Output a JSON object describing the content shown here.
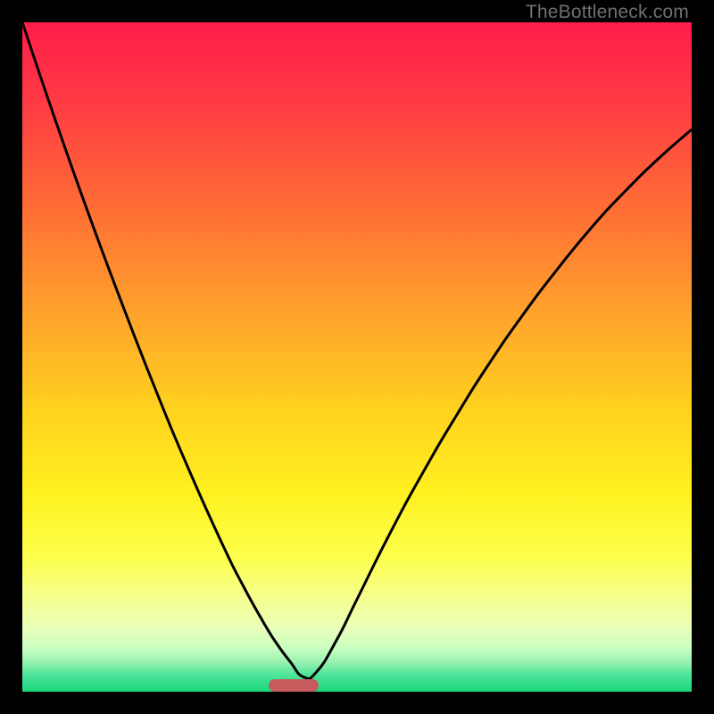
{
  "watermark": "TheBottleneck.com",
  "chart_data": {
    "type": "line",
    "title": "",
    "xlabel": "",
    "ylabel": "",
    "xlim": [
      0,
      1
    ],
    "ylim": [
      0,
      1
    ],
    "x": [
      0.0,
      0.05,
      0.1,
      0.15,
      0.2,
      0.25,
      0.3,
      0.33,
      0.36,
      0.38,
      0.4,
      0.42,
      0.44,
      0.47,
      0.5,
      0.55,
      0.6,
      0.65,
      0.7,
      0.75,
      0.8,
      0.85,
      0.9,
      0.95,
      1.0
    ],
    "y": [
      1.0,
      0.852,
      0.711,
      0.577,
      0.449,
      0.329,
      0.218,
      0.158,
      0.104,
      0.072,
      0.045,
      0.022,
      0.03,
      0.078,
      0.138,
      0.238,
      0.33,
      0.415,
      0.494,
      0.566,
      0.632,
      0.693,
      0.747,
      0.796,
      0.84
    ],
    "gradient_stops": [
      {
        "pos": 0.0,
        "color": "#ff1c4a"
      },
      {
        "pos": 0.12,
        "color": "#ff3b44"
      },
      {
        "pos": 0.28,
        "color": "#ff6e35"
      },
      {
        "pos": 0.45,
        "color": "#ffa82b"
      },
      {
        "pos": 0.58,
        "color": "#ffd21e"
      },
      {
        "pos": 0.7,
        "color": "#fff01f"
      },
      {
        "pos": 0.8,
        "color": "#fdff4d"
      },
      {
        "pos": 0.86,
        "color": "#f5ff8f"
      },
      {
        "pos": 0.905,
        "color": "#e8ffb8"
      },
      {
        "pos": 0.935,
        "color": "#c9ffc0"
      },
      {
        "pos": 0.955,
        "color": "#9cf2b2"
      },
      {
        "pos": 0.975,
        "color": "#4de59a"
      },
      {
        "pos": 1.0,
        "color": "#18d87a"
      }
    ],
    "marker": {
      "x_center": 0.405,
      "width": 0.075,
      "color": "#c65a5c"
    },
    "curve_stroke": "#000000",
    "curve_width": 3
  }
}
